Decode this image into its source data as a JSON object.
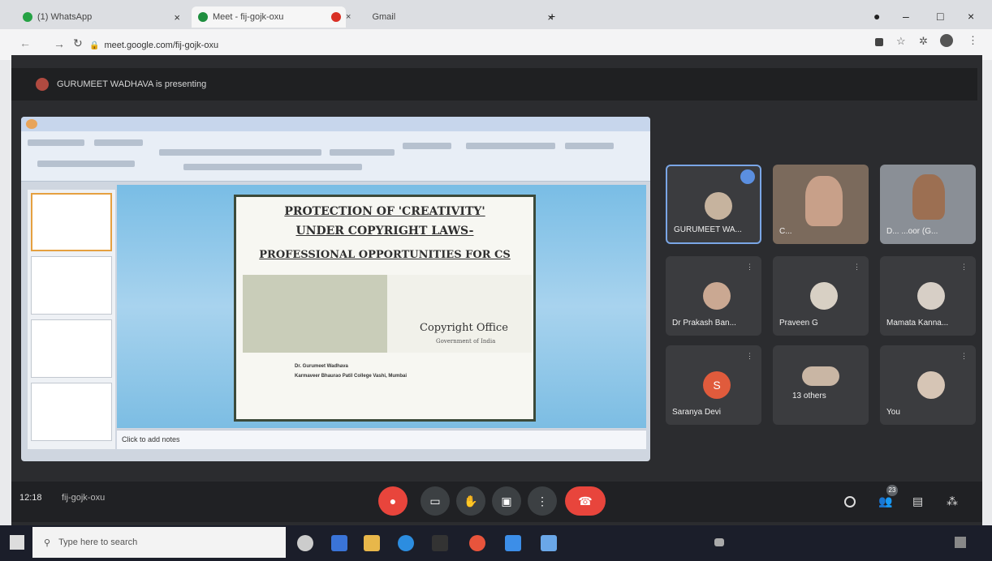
{
  "tabs": [
    {
      "label": "(1) WhatsApp",
      "close": "×"
    },
    {
      "label": "Meet - fij-gojk-oxu",
      "close": "×"
    },
    {
      "label": "Gmail",
      "close": "×"
    }
  ],
  "new_tab": "+",
  "window": {
    "min": "–",
    "max": "□",
    "close": "×"
  },
  "address": {
    "url": "meet.google.com/fij-gojk-oxu"
  },
  "meet": {
    "presenting_text": "GURUMEET WADHAVA is presenting",
    "slide_lines": [
      "PROTECTION OF 'CREATIVITY'",
      "UNDER COPYRIGHT LAWS-",
      "PROFESSIONAL OPPORTUNITIES FOR CS"
    ],
    "copyright_office": "Copyright Office",
    "govt_of_india": "Government of India",
    "author_name": "Dr. Gurumeet Wadhava",
    "author_college": "Karmaveer Bhaurao Patil College Vashi, Mumbai",
    "notes_placeholder": "Click to add notes",
    "participants": [
      {
        "name": "GURUMEET WA..."
      },
      {
        "name": "C..."
      },
      {
        "name": "D... ...oor (G..."
      },
      {
        "name": "Dr Prakash Ban..."
      },
      {
        "name": "Praveen G"
      },
      {
        "name": "Mamata Kanna..."
      },
      {
        "name": "Saranya Devi",
        "initial": "S"
      },
      {
        "name": "13 others"
      },
      {
        "name": "You"
      }
    ],
    "time": "12:18",
    "meeting_code": "fij-gojk-oxu",
    "participants_count": "23"
  },
  "taskbar": {
    "search_placeholder": "Type here to search"
  }
}
